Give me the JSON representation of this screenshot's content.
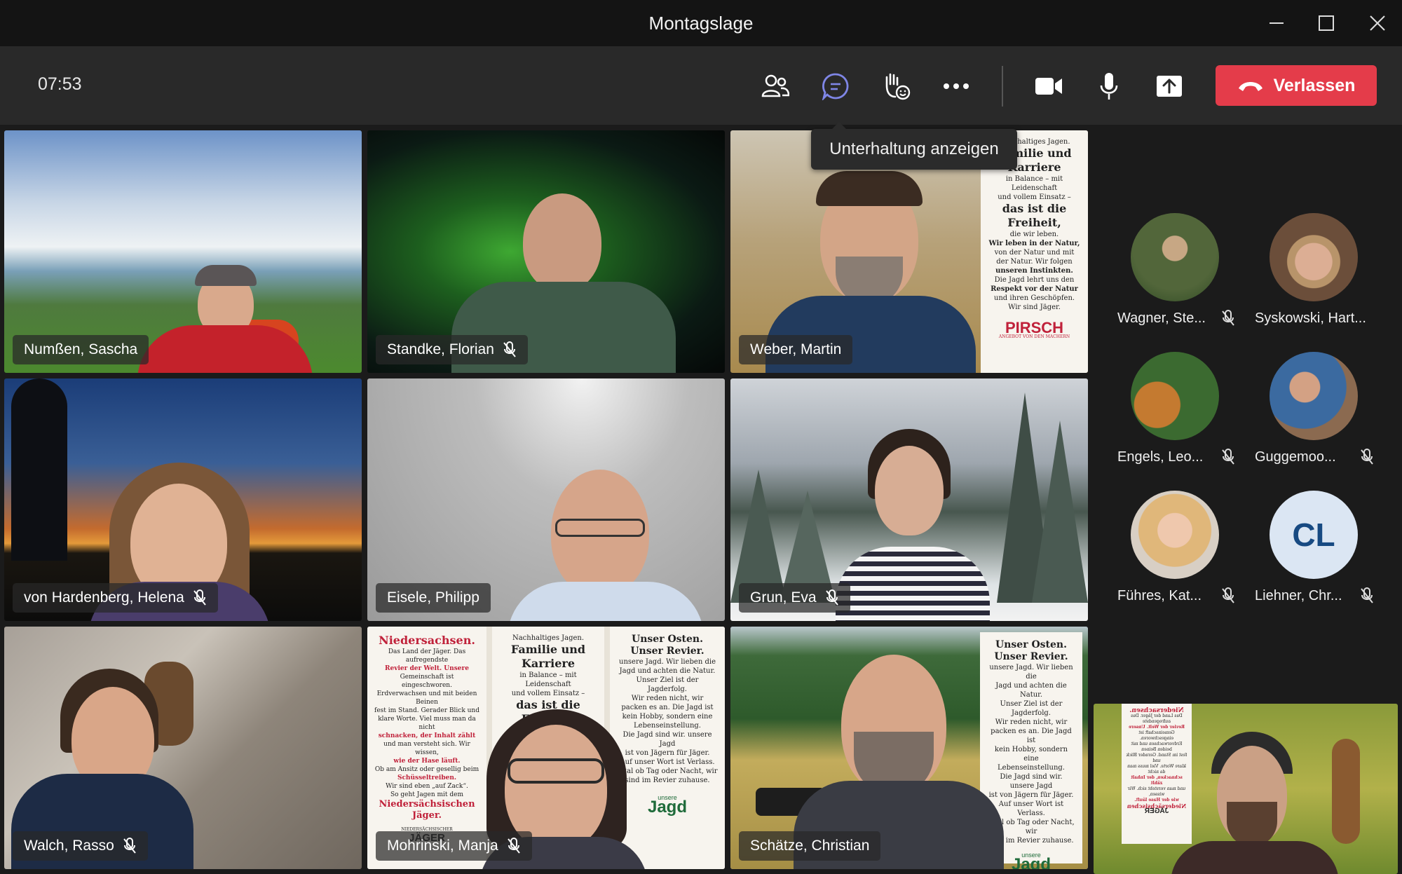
{
  "window": {
    "title": "Montagslage"
  },
  "toolbar": {
    "timer": "07:53",
    "leave_label": "Verlassen",
    "tooltip": "Unterhaltung anzeigen",
    "leave_color": "#e43c4a"
  },
  "tiles": [
    {
      "name": "Numßen, Sascha",
      "muted": false
    },
    {
      "name": "Standke, Florian",
      "muted": true
    },
    {
      "name": "Weber, Martin",
      "muted": false
    },
    {
      "name": "von Hardenberg, Helena",
      "muted": true
    },
    {
      "name": "Eisele, Philipp",
      "muted": false
    },
    {
      "name": "Grun, Eva",
      "muted": true
    },
    {
      "name": "Walch, Rasso",
      "muted": true
    },
    {
      "name": "Mohrinski, Manja",
      "muted": true
    },
    {
      "name": "Schätze, Christian",
      "muted": false,
      "speaking": true
    }
  ],
  "posters": {
    "pirsch_logo": "PIRSCH",
    "pirsch_sub": "ANGEBOT VON DEN MACHERN",
    "weber_text": [
      "Nachhaltiges Jagen.",
      "Familie und Karriere",
      "in Balance – mit Leidenschaft",
      "und vollem Einsatz –",
      "das ist die Freiheit,",
      "die wir leben.",
      "Wir leben in der Natur,",
      "von der Natur und mit",
      "der Natur. Wir folgen",
      "unseren Instinkten.",
      "Die Jagd lehrt uns den",
      "Respekt vor der Natur",
      "und ihren Geschöpfen.",
      "Wir sind Jäger."
    ],
    "nds_text": [
      "Niedersachsen.",
      "Das Land der Jäger. Das aufregendste",
      "Revier der Welt. Unsere",
      "Gemeinschaft ist eingeschworen.",
      "Erdverwachsen und mit beiden Beinen",
      "fest im Stand. Gerader Blick und",
      "klare Worte. Viel muss man da nicht",
      "schnacken, der Inhalt zählt",
      "und man versteht sich. Wir wissen,",
      "wie der Hase läuft.",
      "Ob am Ansitz oder gesellig beim",
      "Schüsseltreiben.",
      "Wir sind eben „auf Zack“.",
      "So geht Jagen mit dem",
      "Niedersächsischen",
      "Jäger."
    ],
    "nds_logo_top": "NIEDERSÄCHSISCHER",
    "nds_logo": "JÄGER",
    "osten_title": "Unser Osten. Unser Revier.",
    "osten_text": [
      "unsere Jagd. Wir lieben die",
      "Jagd und achten die Natur.",
      "Unser Ziel ist der Jagderfolg.",
      "Wir reden nicht, wir",
      "packen es an. Die Jagd ist",
      "kein Hobby, sondern eine",
      "Lebenseinstellung.",
      "Die Jagd sind wir. unsere Jagd",
      "ist von Jägern für Jäger.",
      "Auf unser Wort ist Verlass.",
      "Egal ob Tag oder Nacht, wir",
      "sind im Revier zuhause."
    ],
    "unsere": "unsere",
    "jagd": "Jagd"
  },
  "rail": [
    {
      "name": "Wagner, Ste...",
      "muted": true
    },
    {
      "name": "Syskowski, Hart...",
      "muted": false
    },
    {
      "name": "Engels, Leo...",
      "muted": true
    },
    {
      "name": "Guggemoo...",
      "muted": true
    },
    {
      "name": "Führes, Kat...",
      "muted": true
    },
    {
      "name": "Liehner, Chr...",
      "muted": true,
      "initials": "CL"
    }
  ],
  "icons": [
    "minimize-icon",
    "maximize-icon",
    "close-icon",
    "people-icon",
    "chat-icon",
    "raise-hand-icon",
    "more-icon",
    "camera-icon",
    "microphone-icon",
    "share-icon",
    "phone-hangup-icon",
    "mic-off-icon"
  ]
}
